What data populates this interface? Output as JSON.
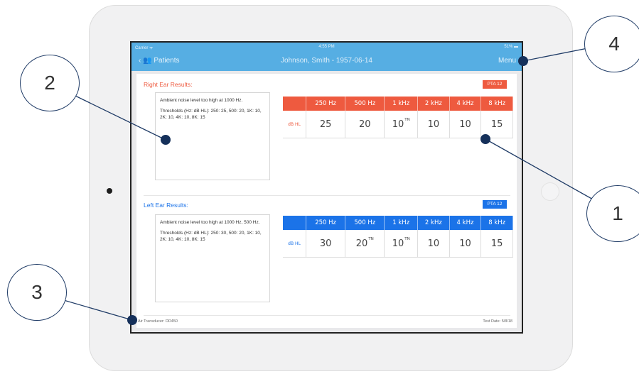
{
  "status_bar": {
    "carrier": "Carrier ᯤ",
    "time": "4:55 PM",
    "battery": "51% ▬"
  },
  "nav": {
    "back_label": "‹ 👥 Patients",
    "title": "Johnson, Smith - 1957-06-14",
    "menu_label": "Menu"
  },
  "right_ear": {
    "title": "Right Ear Results:",
    "pta": "PTA 12",
    "notes": [
      "Ambient noise level too high at 1000 Hz.",
      "Thresholds (Hz: dB HL): 250: 25, 500: 20, 1K: 10, 2K: 10, 4K: 10, 8K: 15"
    ],
    "unit": "dB HL",
    "frequencies": [
      "250 Hz",
      "500 Hz",
      "1 kHz",
      "2 kHz",
      "4 kHz",
      "8 kHz"
    ],
    "values": [
      "25",
      "20",
      "10",
      "10",
      "10",
      "15"
    ],
    "marks": [
      "",
      "",
      "TN",
      "",
      "",
      ""
    ]
  },
  "left_ear": {
    "title": "Left Ear Results:",
    "pta": "PTA 12",
    "notes": [
      "Ambient noise level too high at 1000 Hz, 500 Hz.",
      "Thresholds (Hz: dB HL): 250: 30, 500: 20, 1K: 10, 2K: 10, 4K: 10, 8K: 15"
    ],
    "unit": "dB HL",
    "frequencies": [
      "250 Hz",
      "500 Hz",
      "1 kHz",
      "2 kHz",
      "4 kHz",
      "8 kHz"
    ],
    "values": [
      "30",
      "20",
      "10",
      "10",
      "10",
      "15"
    ],
    "marks": [
      "",
      "TN",
      "TN",
      "",
      "",
      ""
    ]
  },
  "footer": {
    "transducer": "Air Transducer: DD450",
    "test_date": "Test Date: 5/8/18"
  },
  "callouts": [
    "1",
    "2",
    "3",
    "4"
  ],
  "colors": {
    "nav_blue": "#56aee3",
    "right_red": "#ee5a3f",
    "left_blue": "#1b73e8",
    "callout_border": "#1f3b66"
  }
}
